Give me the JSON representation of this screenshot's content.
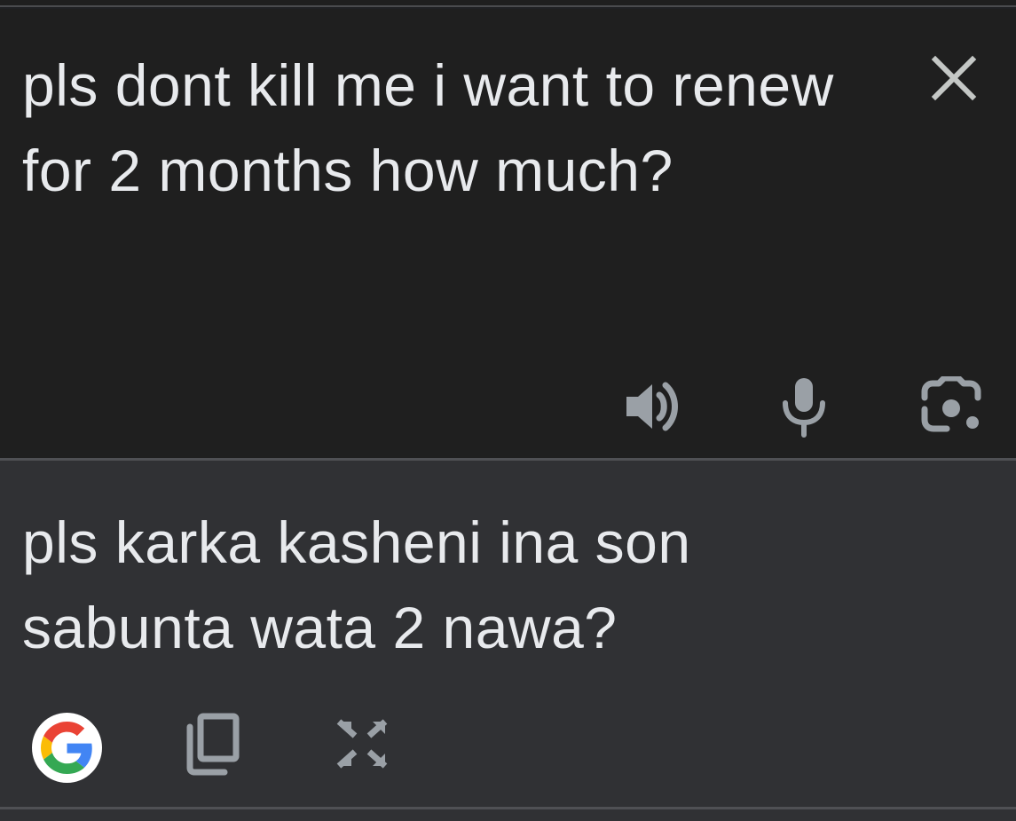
{
  "source": {
    "text": "pls dont kill me i want to renew for 2 months how much?"
  },
  "result": {
    "text": "pls karka kasheni ina son sabunta wata 2 nawa?"
  },
  "icons": {
    "close": "close-icon",
    "speaker": "speaker-icon",
    "microphone": "microphone-icon",
    "camera_lens": "camera-lens-icon",
    "google": "google-logo-icon",
    "copy": "copy-icon",
    "expand": "fullscreen-icon"
  },
  "colors": {
    "source_bg": "#1f1f1f",
    "result_bg": "#303134",
    "text": "#e8eaed",
    "icon": "#9aa0a6",
    "close_icon": "#c4c7c5",
    "divider": "#4f5054"
  }
}
